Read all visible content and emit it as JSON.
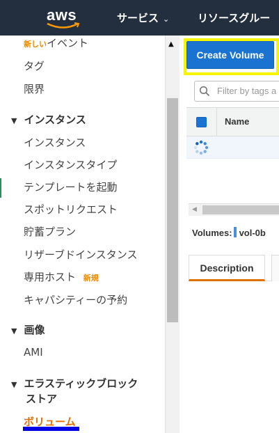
{
  "nav": {
    "logo_text": "aws",
    "services_label": "サービス",
    "services_caret": "⌄",
    "resource_groups_label": "リソースグルー"
  },
  "sidebar": {
    "items": [
      {
        "label": "イベント",
        "badge": "新しい"
      },
      {
        "label": "タグ"
      },
      {
        "label": "限界"
      }
    ],
    "instances": {
      "section_label": "インスタンス",
      "items": [
        {
          "label": "インスタンス"
        },
        {
          "label": "インスタンスタイプ"
        },
        {
          "label": "テンプレートを起動"
        },
        {
          "label": "スポットリクエスト"
        },
        {
          "label": "貯蓄プラン"
        },
        {
          "label": "リザーブドインスタンス"
        },
        {
          "label": "専用ホスト",
          "badge": "新規"
        },
        {
          "label": "キャパシティーの予約"
        }
      ]
    },
    "images": {
      "section_label": "画像",
      "items": [
        {
          "label": "AMI"
        }
      ]
    },
    "ebs": {
      "section_label_line1": "エラスティックブロック",
      "section_label_line2": "ストア",
      "active_item": "ボリューム"
    },
    "section_triangle": "▼"
  },
  "main": {
    "create_button": "Create Volume",
    "filter_placeholder": "Filter by tags a",
    "table": {
      "columns": [
        "Name"
      ]
    },
    "volumes_label": "Volumes:",
    "volume_id": "vol-0b",
    "tabs": [
      {
        "label": "Description"
      }
    ]
  },
  "colors": {
    "nav_bg": "#232f3e",
    "primary_button": "#1a73d0",
    "highlight": "#f5f500",
    "active": "#e07000",
    "badge": "#e88b00",
    "underline": "#0000e6"
  }
}
